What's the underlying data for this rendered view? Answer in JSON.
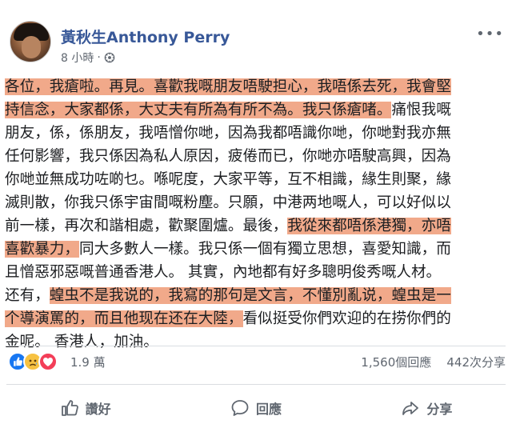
{
  "post_header": {
    "author": "黃秋生Anthony Perry",
    "timestamp": "8 小時",
    "separator": "·",
    "more_label": "•••",
    "avatar_icon": "profile-photo",
    "audience_icon": "globe-icon"
  },
  "post_body": {
    "highlight_color": "#f1a98a",
    "lines": [
      [
        {
          "t": "各位，我瘡啦。再見。喜歡我嘅朋友唔駛担心，我唔係去死，我會堅",
          "h": true
        }
      ],
      [
        {
          "t": "持信念，大家都係，大丈夫有所為有所不為。我只係瘡啫。",
          "h": true
        },
        {
          "t": "痛恨我嘅",
          "h": false
        }
      ],
      [
        {
          "t": "朋友，係，係朋友，我唔憎你哋，因為我都唔識你哋，你哋對我亦無",
          "h": false
        }
      ],
      [
        {
          "t": "任何影響，我只係因為私人原因，疲倦而已，你哋亦唔駛高興，因為",
          "h": false
        }
      ],
      [
        {
          "t": "你哋並無成功咗啲乜。喺呢度，大家平等，互不相識，緣生則聚，緣",
          "h": false
        }
      ],
      [
        {
          "t": "滅則散，你我只係宇宙間嘅粉塵。只願，中港两地嘅人，可以好似以",
          "h": false
        }
      ],
      [
        {
          "t": "前一樣，再次和諧相處，歡聚圍爐。最後，",
          "h": false
        },
        {
          "t": "我從來都唔係港獨，亦唔",
          "h": true
        }
      ],
      [
        {
          "t": "喜歡暴力，",
          "h": true
        },
        {
          "t": "同大多數人一樣。我只係一個有獨立思想，喜愛知識，而",
          "h": false
        }
      ],
      [
        {
          "t": "且憎惡邪惡嘅普通香港人。 其實，內地都有好多聰明俊秀嘅人材。",
          "h": false
        }
      ],
      [
        {
          "t": "还有，",
          "h": false
        },
        {
          "t": "蝗虫不是我说的，我寫的那句是文言，不懂別亂说，蝗虫是一",
          "h": true
        }
      ],
      [
        {
          "t": "个導演罵的，而且他现在还在大陸，",
          "h": true
        },
        {
          "t": "看似挺受你們欢迎的在捞你們的",
          "h": false
        }
      ],
      [
        {
          "t": "金呢。 香港人，加油。",
          "h": false
        }
      ]
    ]
  },
  "stats": {
    "reaction_icons": [
      "like-icon",
      "sad-icon",
      "love-icon"
    ],
    "reactions_count": "1.9 萬",
    "comments_count": "1,560個回應",
    "shares_count": "442次分享"
  },
  "actions": {
    "like_label": "讚好",
    "comment_label": "回應",
    "share_label": "分享"
  }
}
